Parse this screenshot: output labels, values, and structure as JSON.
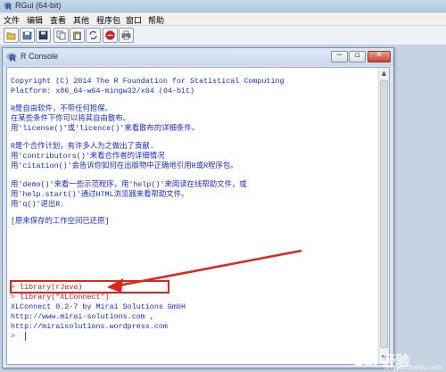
{
  "app": {
    "title": "RGui (64-bit)",
    "icon": "r-logo-icon"
  },
  "menubar": {
    "items": [
      "文件",
      "编辑",
      "查看",
      "其他",
      "程序包",
      "窗口",
      "帮助"
    ]
  },
  "toolbar": {
    "buttons": [
      "open-script-icon",
      "load-workspace-icon",
      "save-workspace-icon",
      "copy-icon",
      "paste-icon",
      "copy-paste-icon",
      "stop-icon",
      "print-icon"
    ]
  },
  "console": {
    "title": "R Console",
    "window_buttons": {
      "minimize": "−",
      "maximize": "▫",
      "close": "✕"
    },
    "lines": [
      "Copyright (C) 2014 The R Foundation for Statistical Computing",
      "Platform: x86_64-w64-mingw32/x64 (64-bit)",
      "R是自由软件，不带任何担保。",
      "在某些条件下你可以将其自由散布。",
      "用'license()'或'licence()'来看散布的详细条件。",
      "R是个合作计划，有许多人为之做出了贡献.",
      "用'contributors()'来看合作者的详细情况",
      "用'citation()'会告诉你如何在出版物中正确地引用R或R程序包。",
      "用'demo()'来看一些示范程序，用'help()'来阅读在线帮助文件，或",
      "用'help.start()'通过HTML浏览器来看帮助文件。",
      "用'q()'退出R.",
      "[原来保存的工作空间已还原]",
      "> library(rJava)",
      "> library(\"XLConnect\")",
      "XLConnect 0.2-7 by Mirai Solutions GmbH",
      "http://www.mirai-solutions.com ,",
      "http://miraisolutions.wordpress.com",
      "> "
    ]
  },
  "colors": {
    "output": "#1a2bcf",
    "input": "#d0161a",
    "annotation": "#e0241e"
  },
  "watermark": {
    "brand": "Bai 经验",
    "site": "jingyan.baidu.com"
  }
}
